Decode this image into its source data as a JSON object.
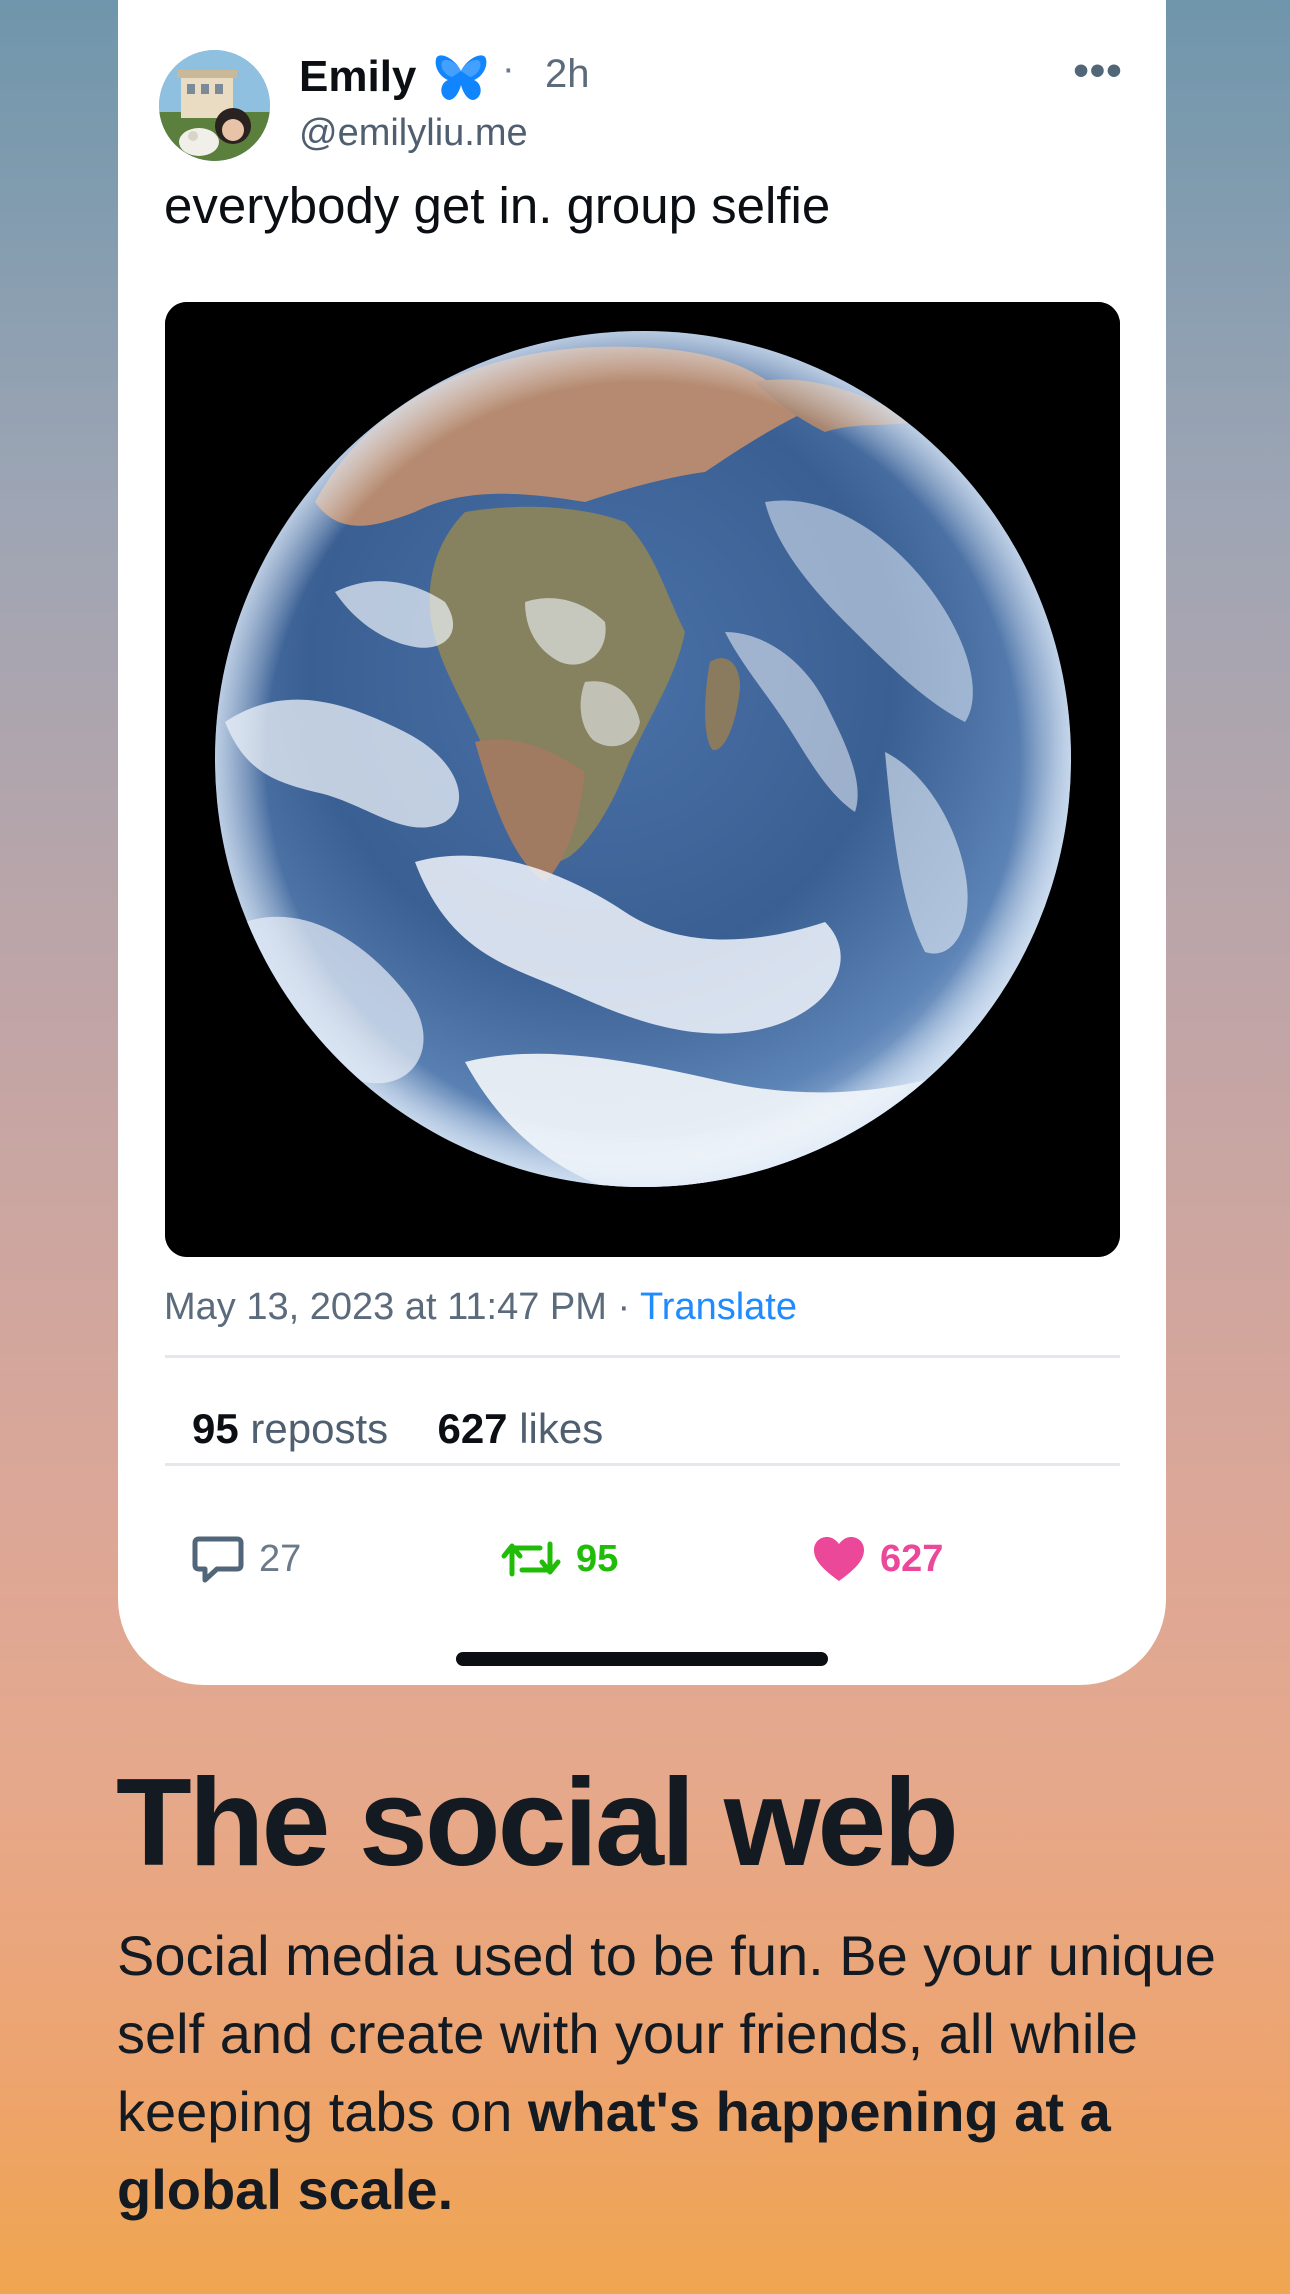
{
  "post": {
    "author_name": "Emily",
    "author_badge": "butterfly-icon",
    "time_separator": "·",
    "time_ago": "2h",
    "handle": "@emilyliu.me",
    "more_label": "•••",
    "text": "everybody get in. group selfie",
    "timestamp": "May 13, 2023 at 11:47 PM",
    "meta_separator": "·",
    "translate_label": "Translate"
  },
  "stats": {
    "reposts_count": "95",
    "reposts_label": "reposts",
    "likes_count": "627",
    "likes_label": "likes"
  },
  "actions": {
    "replies": "27",
    "reposts": "95",
    "likes": "627"
  },
  "colors": {
    "accent": "#208bfe",
    "repost_green": "#20bc07",
    "like_pink": "#ec4899",
    "muted_text": "#5b6b7c"
  },
  "marketing": {
    "headline": "The social web",
    "body": "Social media used to be fun. Be your unique self and create with your friends, all while keeping tabs on",
    "body_emphasis": "what's happening at a global scale."
  }
}
